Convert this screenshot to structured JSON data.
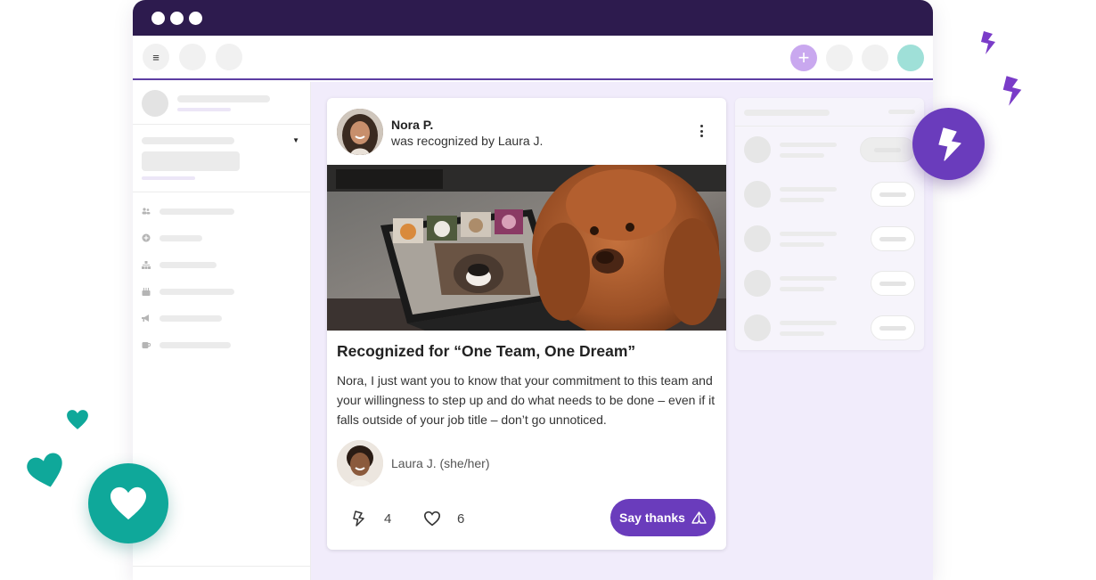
{
  "colors": {
    "titlebar": "#2d1b4e",
    "accent": "#6a3cbc",
    "main_bg": "#f1ecfb",
    "teal": "#0fa89a",
    "lightning": "#7a3cc8"
  },
  "topbar": {
    "menu_icon": "≡",
    "create_icon": "+"
  },
  "post": {
    "poster_name": "Nora P.",
    "recognized_line": "was recognized by Laura J.",
    "title": "Recognized for “One Team, One Dream”",
    "body": "Nora, I just want you to know that your commitment to this team and your willingness to step up and do what needs to be done – even if it falls outside of your job title – don’t go unnoticed.",
    "author": "Laura J. (she/her)",
    "boost_count": "4",
    "like_count": "6",
    "say_thanks": "Say thanks",
    "image_icon": "video-call-dogs-photo"
  },
  "icons": {
    "boost": "lightning-icon",
    "like": "heart-icon",
    "thanks": "hands-icon",
    "more": "more-vertical-icon"
  }
}
